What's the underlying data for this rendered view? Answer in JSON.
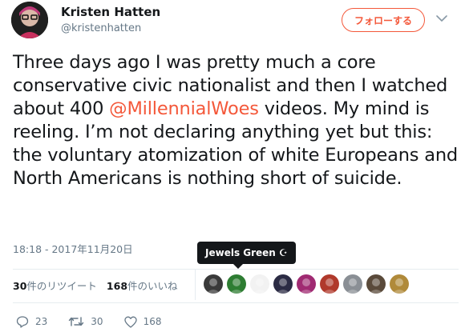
{
  "author": {
    "display_name": "Kristen Hatten",
    "handle": "@kristenhatten"
  },
  "follow_button": {
    "label": "フォローする"
  },
  "tweet": {
    "text_before_mention": "Three days ago I was pretty much a core conservative civic nationalist and then I watched about 400 ",
    "mention": "@MillennialWoes",
    "text_after_mention": " videos. My mind is reeling. I’m not declaring anything yet but this: the voluntary atomization of white Europeans and North Americans is nothing short of suicide.",
    "timestamp": "18:18 - 2017年11月20日"
  },
  "tooltip": {
    "text": "Jewels Green ☪"
  },
  "stats": {
    "retweets_count": "30",
    "retweets_label": "件のリツイート",
    "likes_count": "168",
    "likes_label": "件のいいね"
  },
  "likers": [
    {
      "icon": "avatar-p-logo",
      "color": "#3a3a3a"
    },
    {
      "icon": "avatar-green-face",
      "color": "#2e7d32"
    },
    {
      "icon": "avatar-eagle-crest",
      "color": "#f2f2f2"
    },
    {
      "icon": "avatar-dark-logo",
      "color": "#2b2b44"
    },
    {
      "icon": "avatar-pink-face",
      "color": "#a02a72"
    },
    {
      "icon": "avatar-red-face",
      "color": "#b0392b"
    },
    {
      "icon": "avatar-statue",
      "color": "#8a8f95"
    },
    {
      "icon": "avatar-horned",
      "color": "#5a4a3a"
    },
    {
      "icon": "avatar-blond-face",
      "color": "#b08a3a"
    }
  ],
  "actions": {
    "replies": "23",
    "retweets": "30",
    "likes": "168"
  },
  "colors": {
    "accent": "#f4583a",
    "text": "#14171a",
    "muted": "#657786"
  }
}
